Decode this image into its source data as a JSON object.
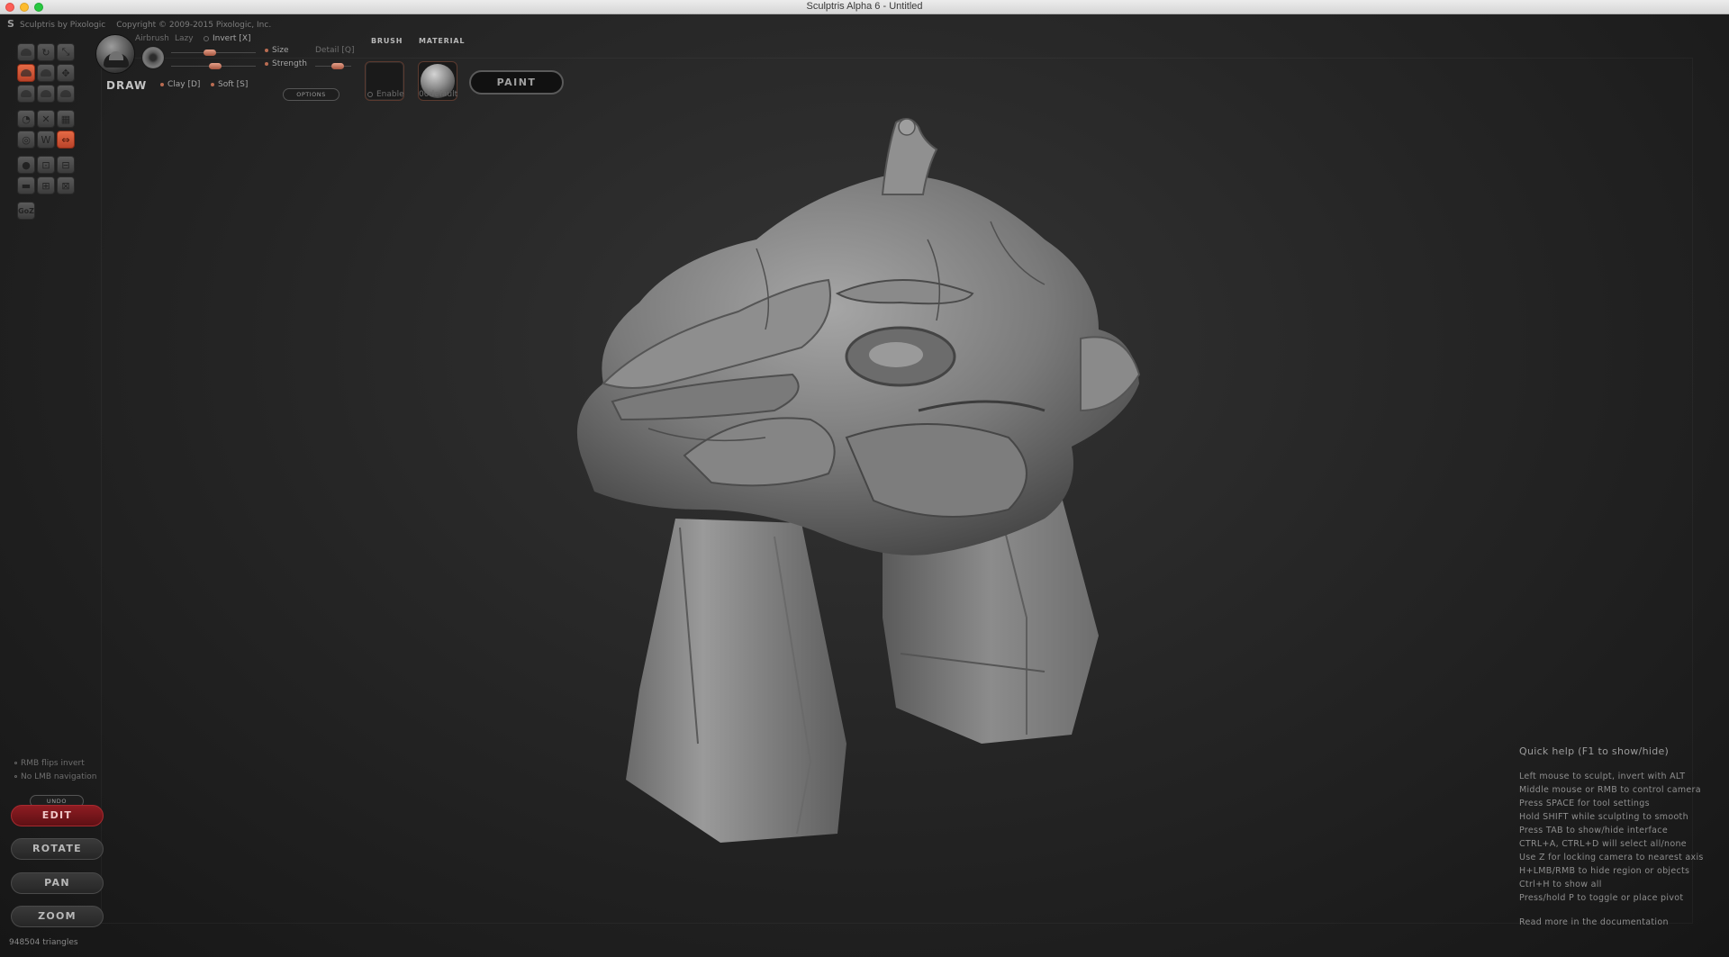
{
  "window": {
    "title": "Sculptris Alpha 6 - Untitled"
  },
  "app": {
    "brand": "Sculptris by Pixologic",
    "copyright": "Copyright © 2009-2015 Pixologic, Inc."
  },
  "toolbar": {
    "tool_name": "DRAW",
    "airbrush_label": "Airbrush",
    "lazy_label": "Lazy",
    "invert_label": "Invert [X]",
    "size_label": "Size",
    "detail_label": "Detail [Q]",
    "strength_label": "Strength",
    "clay_label": "Clay [D]",
    "soft_label": "Soft [S]",
    "options_label": "OPTIONS",
    "brush_title": "BRUSH",
    "brush_enable_label": "Enable",
    "material_title": "MATERIAL",
    "material_name": "00default",
    "paint_label": "PAINT",
    "accent_color": "#e0633d"
  },
  "bottom_left": {
    "rmb_flips": "RMB flips invert",
    "no_lmb_nav": "No LMB navigation",
    "undo_label": "UNDO",
    "edit_label": "EDIT",
    "rotate_label": "ROTATE",
    "pan_label": "PAN",
    "zoom_label": "ZOOM",
    "triangles": "948504 triangles"
  },
  "help": {
    "title": "Quick help (F1 to show/hide)",
    "lines": [
      "Left mouse to sculpt, invert with ALT",
      "Middle mouse or RMB to control camera",
      "Press SPACE for tool settings",
      "Hold SHIFT while sculpting to smooth",
      "Press TAB to show/hide interface",
      "CTRL+A, CTRL+D will select all/none",
      "Use Z for locking camera to nearest axis",
      "H+LMB/RMB to hide region or objects",
      "Ctrl+H to show all",
      "Press/hold P to toggle or place pivot"
    ],
    "more": "Read more in the documentation"
  }
}
